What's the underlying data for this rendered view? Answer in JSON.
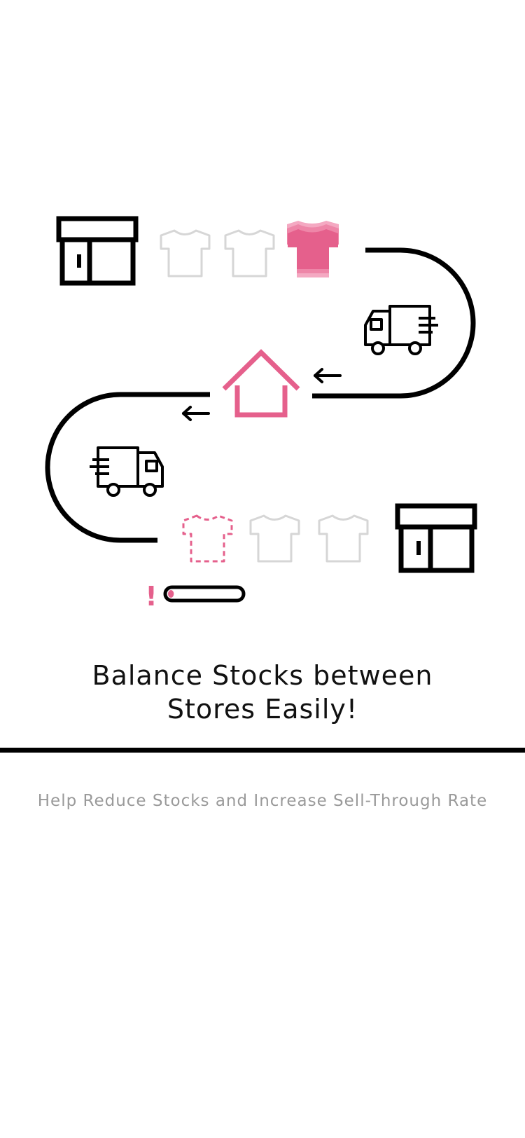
{
  "illustration": {
    "accent_color": "#e5608c",
    "light_accent_color": "#f4a9c2",
    "outline_color": "#000000",
    "empty_shirt_color": "#d6d6d6",
    "icons": {
      "top_store": "store-icon",
      "top_shirts": [
        "tshirt-outline-icon",
        "tshirt-outline-icon",
        "tshirt-stack-filled-icon"
      ],
      "truck_right": "delivery-truck-icon",
      "warehouse": "warehouse-icon",
      "arrows": [
        "left-arrow-icon",
        "left-arrow-icon"
      ],
      "truck_left": "delivery-truck-icon",
      "bottom_shirts": [
        "tshirt-dashed-icon",
        "tshirt-outline-icon",
        "tshirt-outline-icon"
      ],
      "bottom_store": "store-icon",
      "alert": "exclamation-icon",
      "low_stock_bar": "stock-level-bar"
    },
    "alert_mark": "!",
    "low_stock_level": 0.08
  },
  "headline": {
    "line1": "Balance Stocks between",
    "line2": "Stores Easily!"
  },
  "subtitle": "Help Reduce Stocks and Increase Sell-Through Rate"
}
